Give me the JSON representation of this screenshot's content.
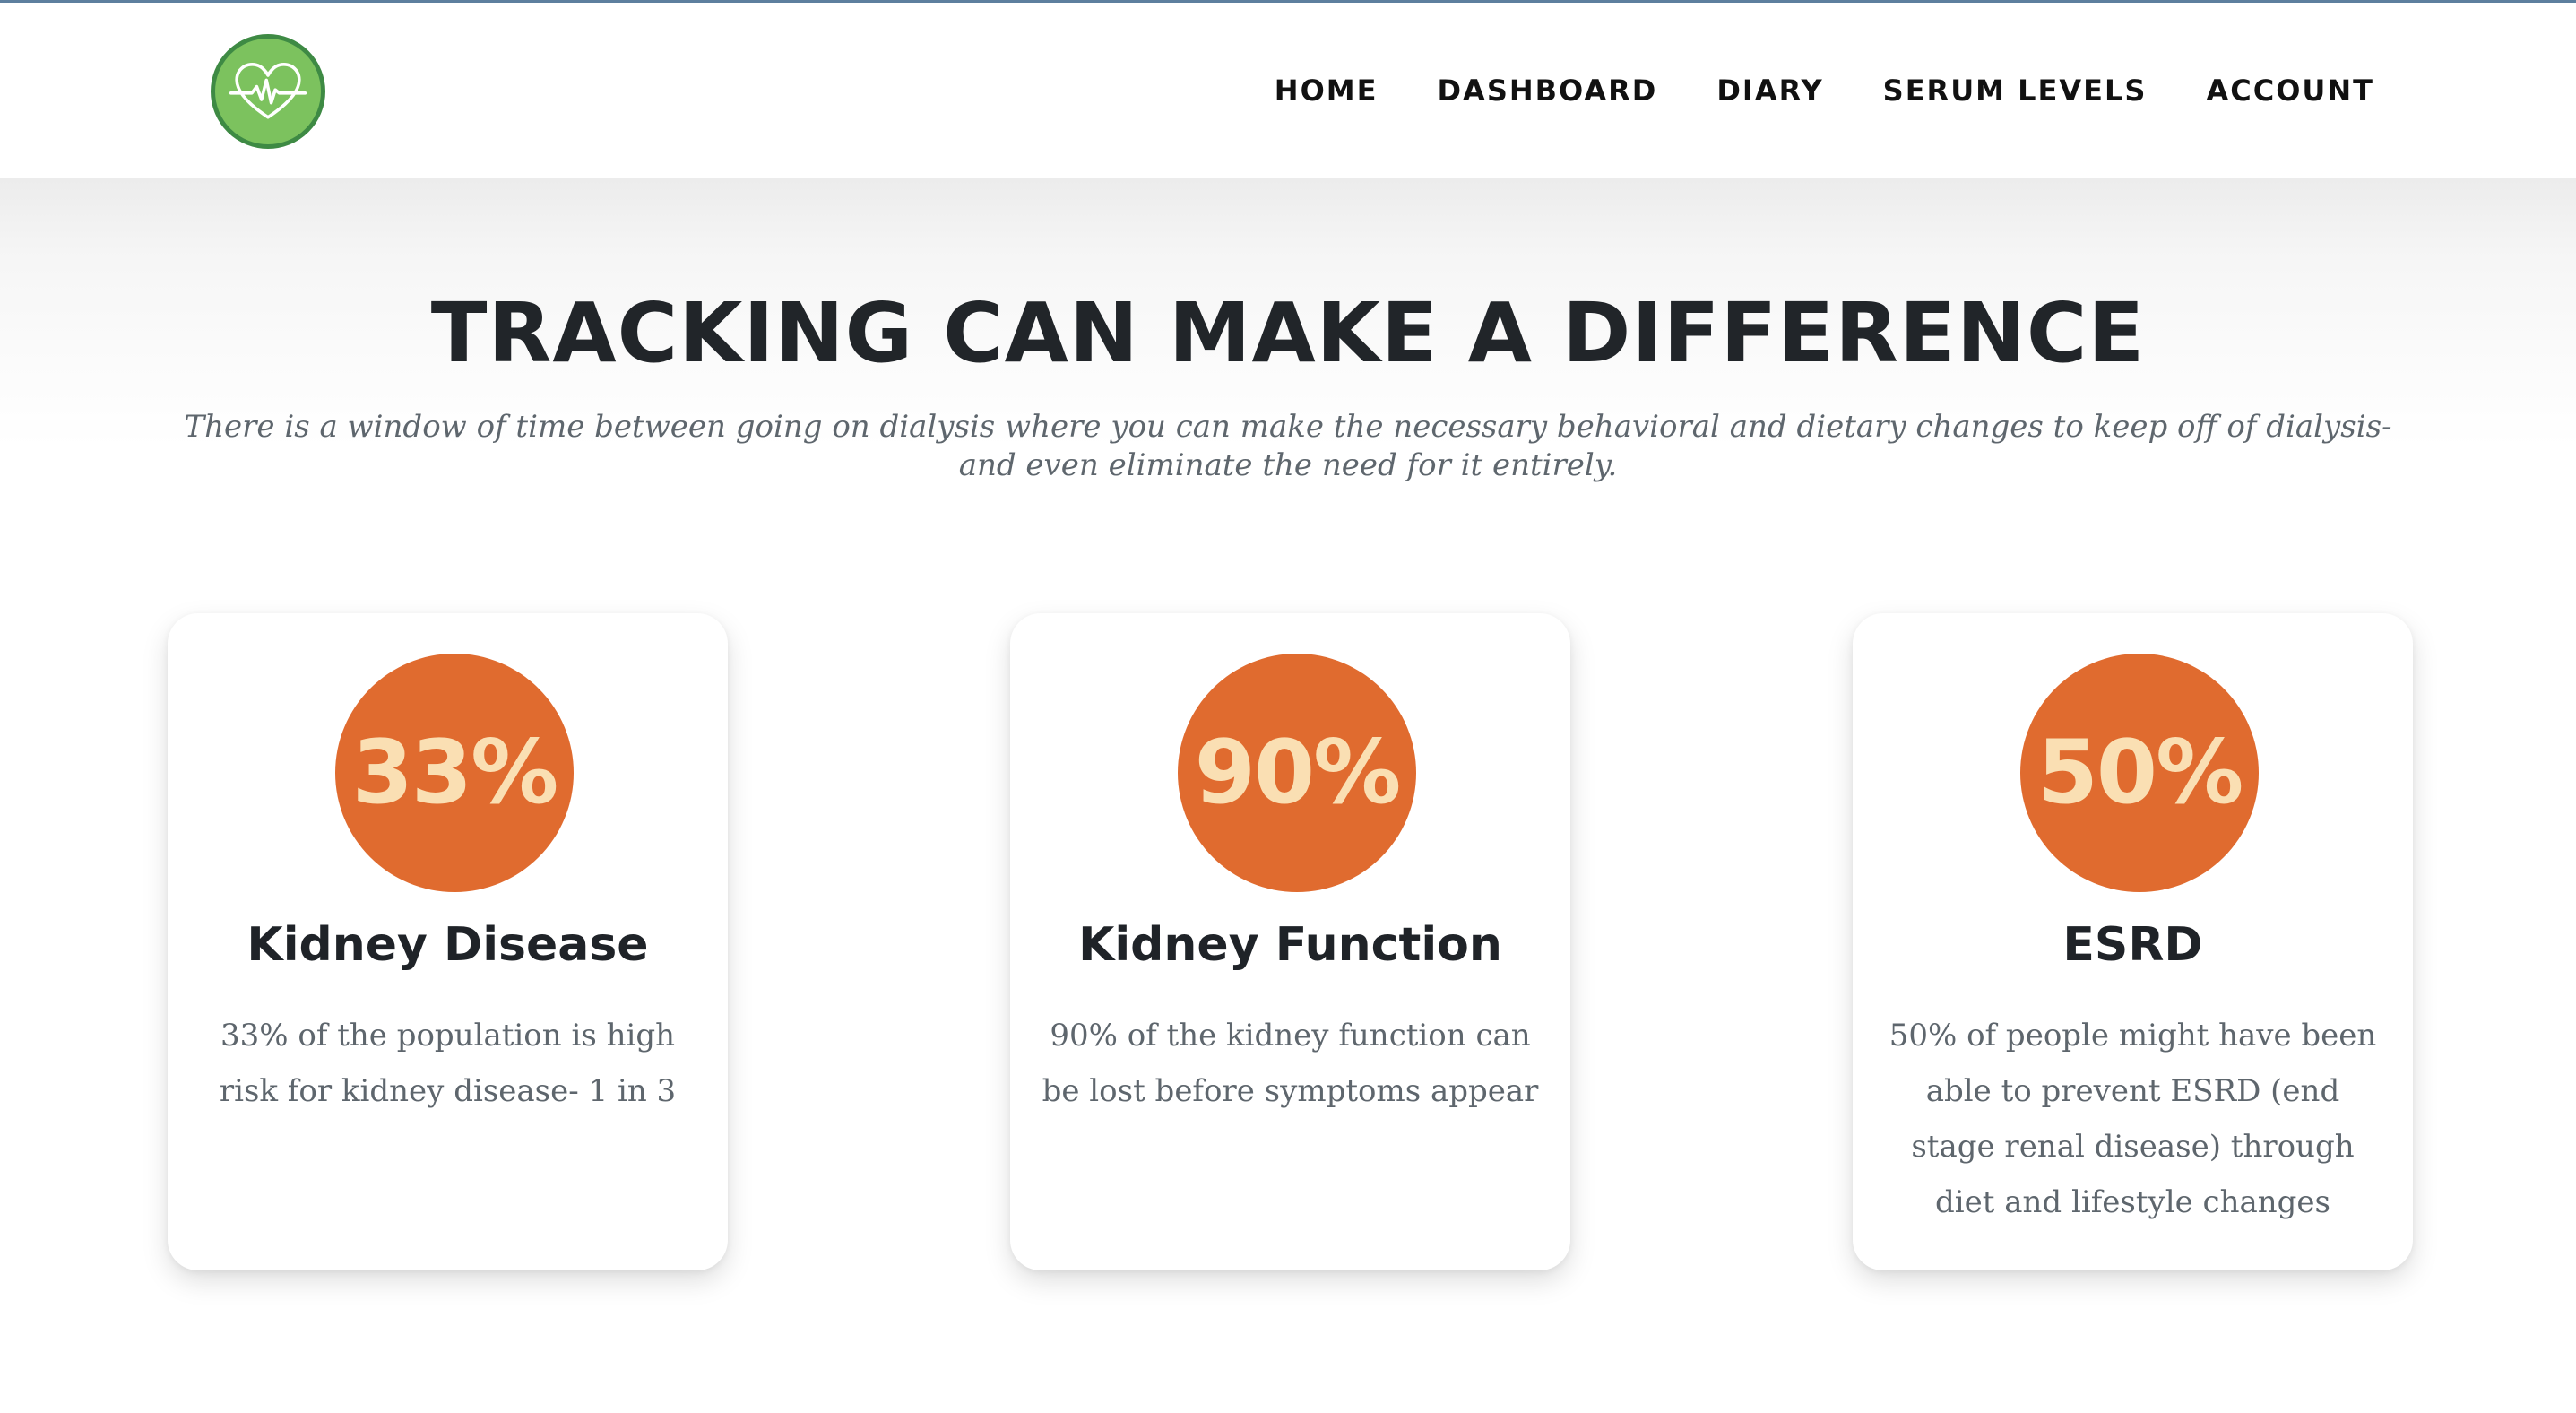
{
  "colors": {
    "accent": "#e06b2f",
    "stat_text": "#fadfb3",
    "logo_green": "#7cc25e",
    "logo_border": "#3e8a44"
  },
  "header": {
    "logo_icon": "heart-pulse-icon",
    "nav": [
      {
        "label": "HOME"
      },
      {
        "label": "DASHBOARD"
      },
      {
        "label": "DIARY"
      },
      {
        "label": "SERUM LEVELS"
      },
      {
        "label": "ACCOUNT"
      }
    ]
  },
  "hero": {
    "title": "TRACKING CAN MAKE A DIFFERENCE",
    "subtitle": "There is a window of time between going on dialysis where you can make the necessary behavioral and dietary changes to keep off of dialysis- and even eliminate the need for it entirely."
  },
  "cards": [
    {
      "value": "33%",
      "title": "Kidney Disease",
      "text": "33% of the population is high risk for kidney disease- 1 in 3"
    },
    {
      "value": "90%",
      "title": "Kidney Function",
      "text": "90% of the kidney function can be lost before symptoms appear"
    },
    {
      "value": "50%",
      "title": "ESRD",
      "text": "50% of people might have been able to prevent ESRD (end stage renal disease) through diet and lifestyle changes"
    }
  ]
}
